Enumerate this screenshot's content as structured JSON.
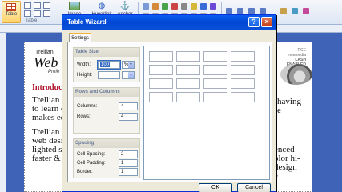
{
  "ribbon": {
    "table_label": "Table",
    "image_label": "Image",
    "hyperlink_label": "Hyperlink",
    "anchor_label": "Anchor",
    "group_label": "Table"
  },
  "document": {
    "logo_top": "Trellian",
    "logo_main": "Web",
    "logo_sub": "Profe",
    "intro_heading": "Introduc",
    "para1_lines": [
      "Trellian",
      "to learn c",
      "makes ed"
    ],
    "para1_right": [
      "having",
      "e"
    ],
    "para2_lines": [
      "Trellian",
      "web desi",
      "lighted s",
      "faster &"
    ],
    "para2_right": [
      "enced",
      "olor hi-",
      "design",
      "e"
    ],
    "banner_lines": [
      "RCE",
      "ncemedia",
      "LASH",
      "ENABLED"
    ]
  },
  "dialog": {
    "title": "Table Wizard",
    "tab_settings": "Settings",
    "table_size": {
      "title": "Table Size",
      "width_label": "Width:",
      "width_value": "100",
      "width_unit": "%",
      "height_label": "Height:"
    },
    "rows_columns": {
      "title": "Rows and Columns",
      "columns_label": "Columns:",
      "columns_value": "4",
      "rows_label": "Rows:",
      "rows_value": "4"
    },
    "spacing": {
      "title": "Spacing",
      "cell_spacing_label": "Cell Spacing:",
      "cell_spacing_value": "2",
      "cell_padding_label": "Cell Padding:",
      "cell_padding_value": "1",
      "border_label": "Border:",
      "border_value": "1"
    },
    "preview_grid": {
      "rows": 4,
      "columns": 4
    },
    "ok_label": "OK",
    "cancel_label": "Cancel"
  },
  "colors": {
    "title_bar": "#0054e3",
    "workspace": "#3f63b7",
    "intro_heading": "#b0122a"
  }
}
